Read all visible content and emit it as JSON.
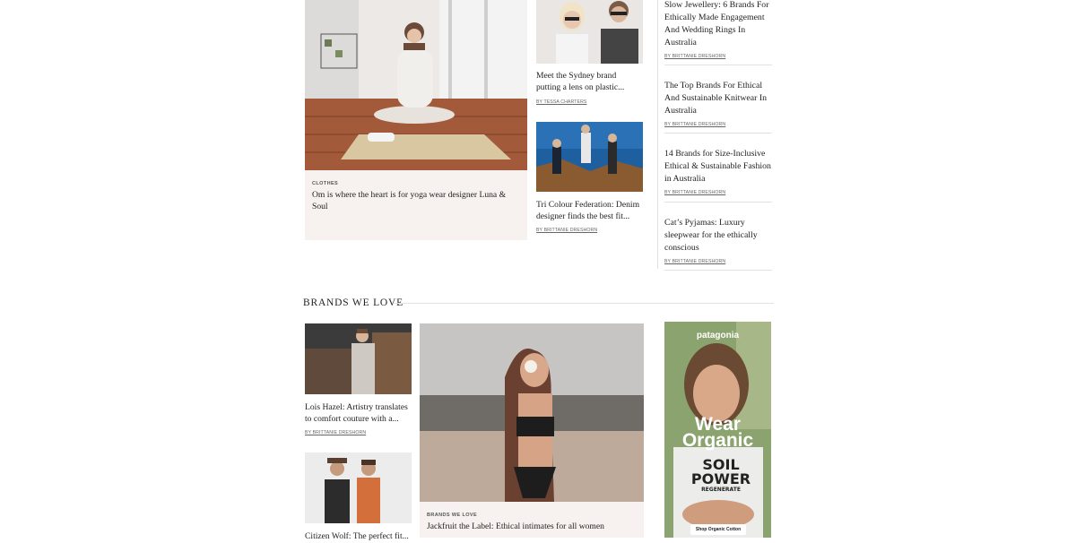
{
  "top_section": {
    "featured": {
      "category": "CLOTHES",
      "title": "Om is where the heart is for yoga wear designer Luna & Soul"
    },
    "middle_articles": [
      {
        "title": "Meet the Sydney brand putting a lens on plastic...",
        "byline": "BY TESSA CHARTERS"
      },
      {
        "title": "Tri Colour Federation: Denim designer finds the best fit...",
        "byline": "BY BRITTANIE DRESHORN"
      }
    ],
    "sidebar_articles": [
      {
        "title": "Slow Jewellery: 6 Brands For Ethically Made Engagement And Wedding Rings In Australia",
        "byline": "BY BRITTANIE DRESHORN"
      },
      {
        "title": "The Top Brands For Ethical And Sustainable Knitwear In Australia",
        "byline": "BY BRITTANIE DRESHORN"
      },
      {
        "title": "14 Brands for Size-Inclusive Ethical & Sustainable Fashion in Australia",
        "byline": "BY BRITTANIE DRESHORN"
      },
      {
        "title": "Cat’s Pyjamas: Luxury sleepwear for the ethically conscious",
        "byline": "BY BRITTANIE DRESHORN"
      }
    ]
  },
  "brands_section": {
    "heading": "BRANDS WE LOVE",
    "left_articles": [
      {
        "title": "Lois Hazel: Artistry translates to comfort couture with a...",
        "byline": "BY BRITTANIE DRESHORN"
      },
      {
        "title": "Citizen Wolf: The perfect fit..."
      }
    ],
    "featured": {
      "category": "BRANDS WE LOVE",
      "title": "Jackfruit the Label: Ethical intimates for all women"
    },
    "ad": {
      "brand": "patagonia",
      "headline_line1": "Wear",
      "headline_line2": "Organic",
      "shirt_text_1": "SOIL",
      "shirt_text_2": "POWER",
      "shirt_text_3": "REGENERATE",
      "cta": "Shop Organic Cotton"
    }
  }
}
